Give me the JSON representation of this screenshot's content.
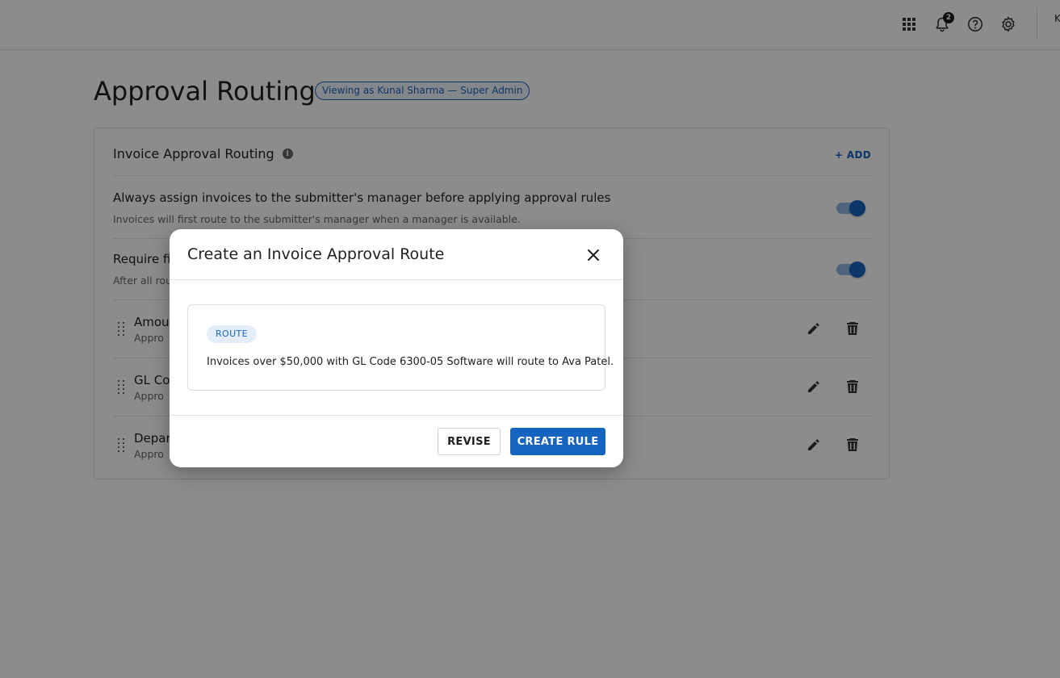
{
  "header": {
    "notification_count": "2",
    "user_initial": "K",
    "icons": [
      "apps-grid-icon",
      "bell-icon",
      "help-icon",
      "gear-icon"
    ]
  },
  "page": {
    "title": "Approval Routing",
    "viewing_as": "Viewing as Kunal Sharma — Super Admin"
  },
  "card": {
    "title": "Invoice Approval Routing",
    "add_label": "+ ADD",
    "settings": [
      {
        "title": "Always assign invoices to the submitter's manager before applying approval rules",
        "subtitle": "Invoices will first route to the submitter's manager when a manager is available.",
        "enabled": true
      },
      {
        "title": "Require fi",
        "subtitle": "After all rou",
        "enabled": true
      }
    ],
    "rules": [
      {
        "name": "Amou",
        "subtitle": "Appro"
      },
      {
        "name": "GL Co",
        "subtitle": "Appro"
      },
      {
        "name": "Depar",
        "subtitle": "Appro"
      }
    ]
  },
  "modal": {
    "title": "Create an Invoice Approval Route",
    "route_chip": "ROUTE",
    "route_text": "Invoices over $50,000 with GL Code 6300-05 Software will route to Ava Patel.",
    "revise_label": "REVISE",
    "create_label": "CREATE RULE"
  },
  "colors": {
    "accent": "#1565c0",
    "toggle_track": "#8fb7e3",
    "chip_bg": "#e3eefa"
  }
}
